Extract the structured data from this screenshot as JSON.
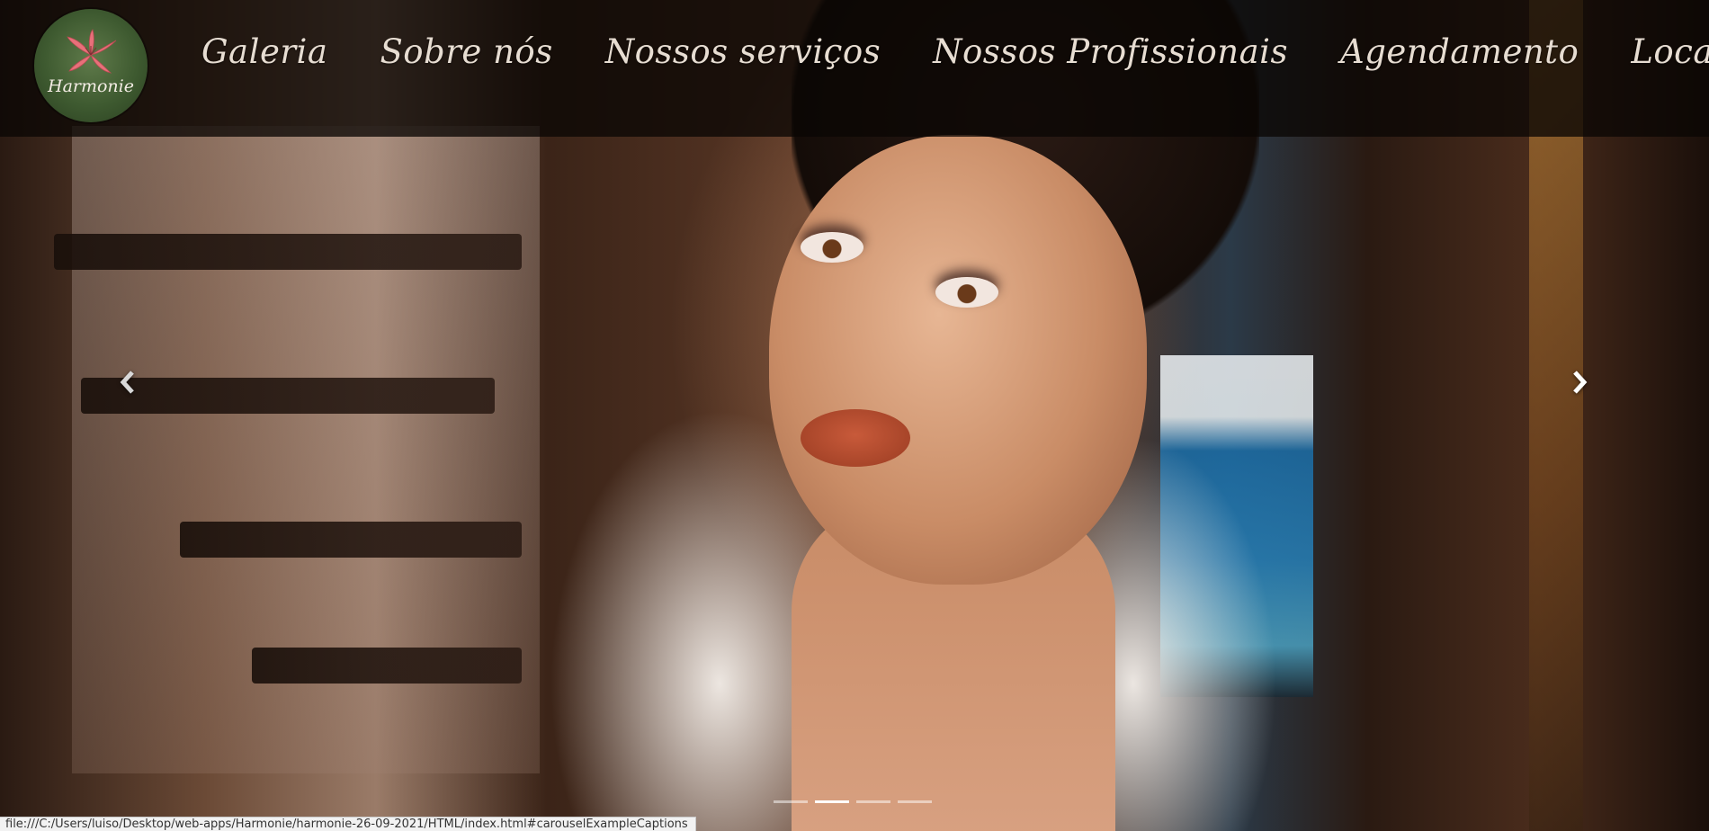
{
  "brand": {
    "logo_text": "Harmonie",
    "logo_icon": "lily-flower-icon"
  },
  "nav": {
    "items": [
      {
        "label": "Galeria"
      },
      {
        "label": "Sobre nós"
      },
      {
        "label": "Nossos serviços"
      },
      {
        "label": "Nossos Profissionais"
      },
      {
        "label": "Agendamento"
      },
      {
        "label": "Localização"
      }
    ]
  },
  "carousel": {
    "prev_icon": "chevron-left-icon",
    "next_icon": "chevron-right-icon",
    "indicator_count": 4,
    "active_indicator": 2
  },
  "status_bar": {
    "url": "file:///C:/Users/luiso/Desktop/web-apps/Harmonie/harmonie-26-09-2021/HTML/index.html#carouselExampleCaptions"
  },
  "colors": {
    "nav_text": "#e7ddd2",
    "navbar_bg": "#0a0604",
    "logo_green": "#3e5a30",
    "flower_pink": "#e8707a"
  }
}
